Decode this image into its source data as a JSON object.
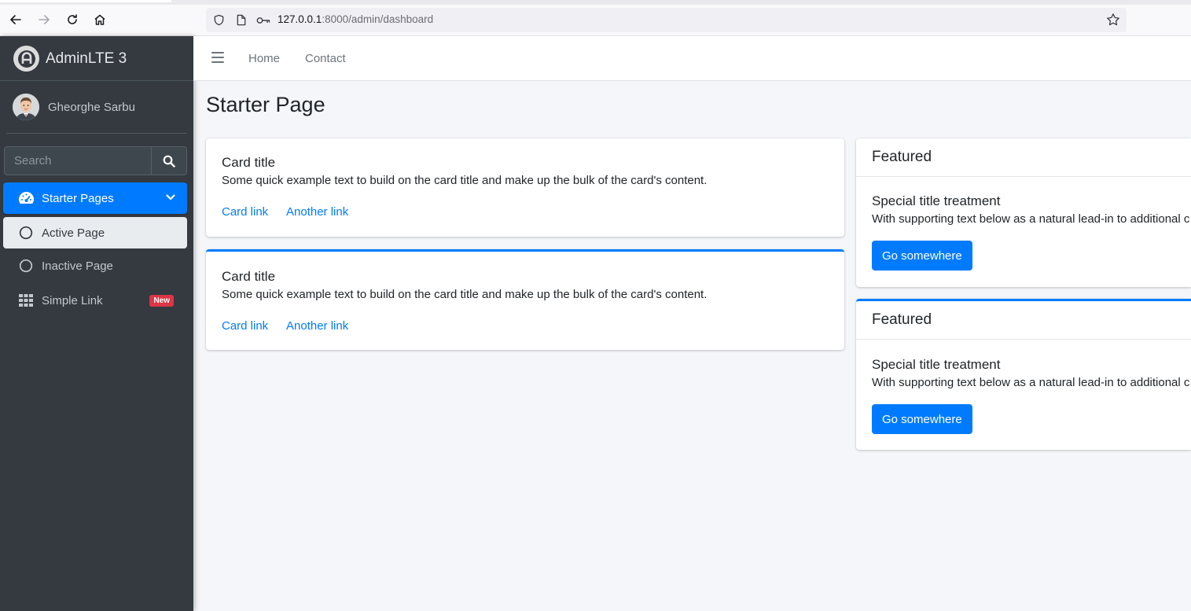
{
  "browser": {
    "url_host": "127.0.0.1",
    "url_rest": ":8000/admin/dashboard"
  },
  "brand": {
    "title": "AdminLTE 3"
  },
  "user": {
    "name": "Gheorghe Sarbu"
  },
  "search": {
    "placeholder": "Search"
  },
  "sidebar": {
    "items": [
      {
        "label": "Starter Pages",
        "icon": "tachometer-icon",
        "state": "open"
      },
      {
        "label": "Active Page",
        "icon": "circle-icon",
        "state": "active"
      },
      {
        "label": "Inactive Page",
        "icon": "circle-icon",
        "state": "inactive"
      },
      {
        "label": "Simple Link",
        "icon": "grid-icon",
        "badge": "New"
      }
    ]
  },
  "topnav": {
    "links": [
      "Home",
      "Contact"
    ]
  },
  "page": {
    "title": "Starter Page"
  },
  "left_cards": [
    {
      "title": "Card title",
      "text": "Some quick example text to build on the card title and make up the bulk of the card's content.",
      "link1": "Card link",
      "link2": "Another link"
    },
    {
      "title": "Card title",
      "text": "Some quick example text to build on the card title and make up the bulk of the card's content.",
      "link1": "Card link",
      "link2": "Another link"
    }
  ],
  "right_cards": [
    {
      "header": "Featured",
      "title": "Special title treatment",
      "text": "With supporting text below as a natural lead-in to additional c",
      "button": "Go somewhere"
    },
    {
      "header": "Featured",
      "title": "Special title treatment",
      "text": "With supporting text below as a natural lead-in to additional c",
      "button": "Go somewhere"
    }
  ],
  "colors": {
    "primary": "#007bff",
    "sidebar_bg": "#343a40",
    "badge_danger": "#dc3545",
    "content_bg": "#f4f6f9"
  }
}
